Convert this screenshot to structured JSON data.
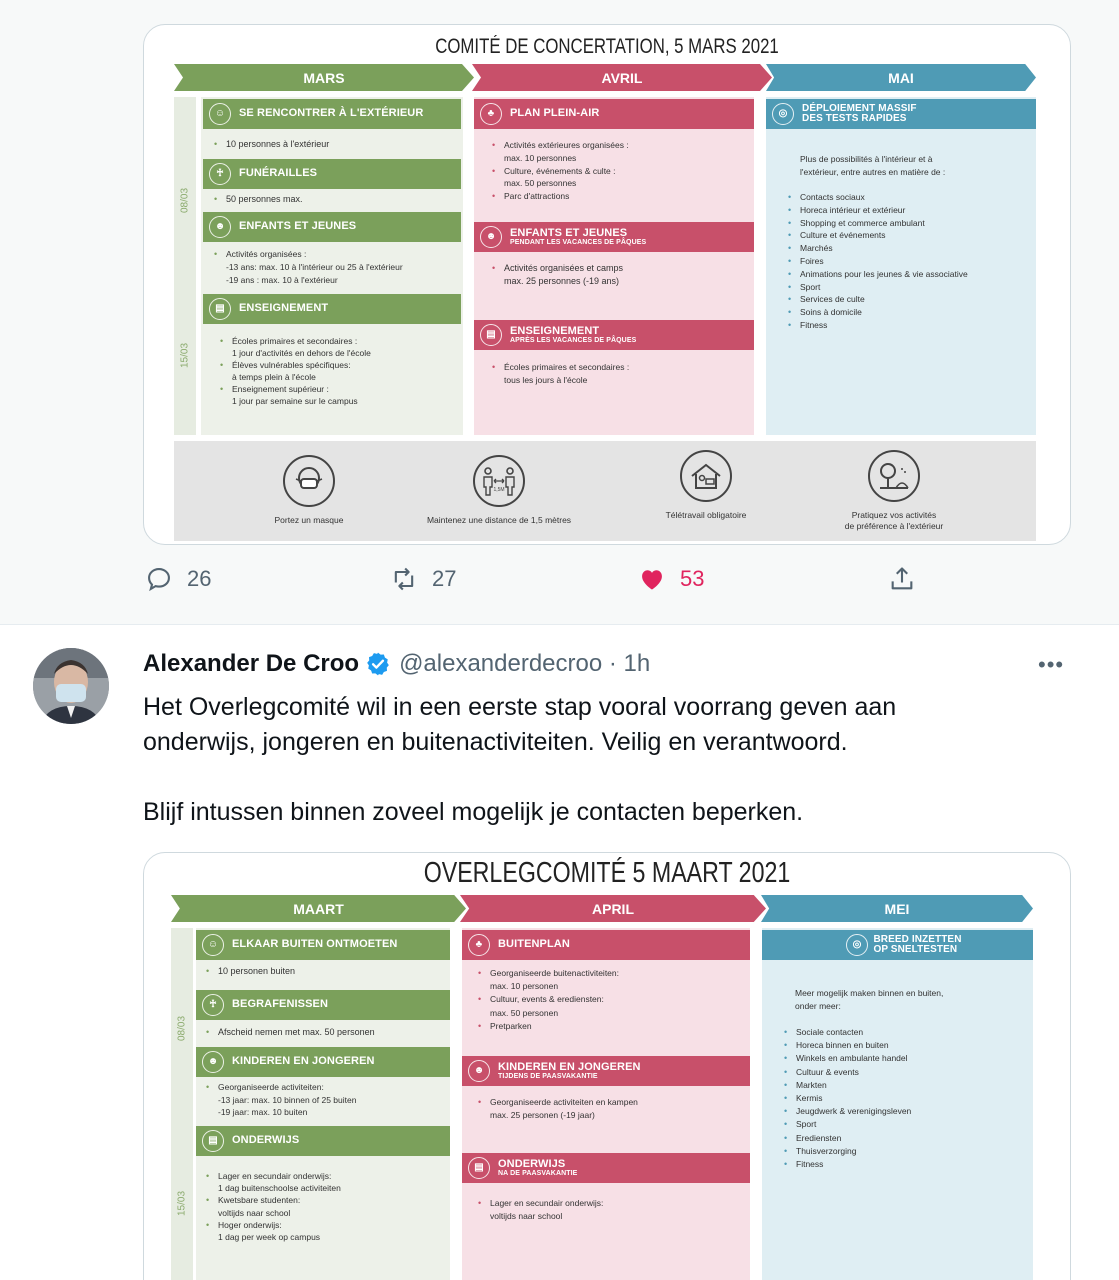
{
  "top_infographic": {
    "title": "COMITÉ DE CONCERTATION, 5 MARS 2021",
    "months": [
      "MARS",
      "AVRIL",
      "MAI"
    ],
    "dates": [
      "08/03",
      "15/03"
    ],
    "col1": {
      "sec1_title": "SE RENCONTRER À L'EXTÉRIEUR",
      "sec1_items": [
        "10 personnes à l'extérieur"
      ],
      "sec2_title": "FUNÉRAILLES",
      "sec2_items": [
        "50 personnes max."
      ],
      "sec3_title": "ENFANTS ET JEUNES",
      "sec3_items": [
        "Activités organisées :\n-13 ans: max. 10 à l'intérieur ou 25 à l'extérieur\n-19 ans : max. 10 à l'extérieur"
      ],
      "sec4_title": "ENSEIGNEMENT",
      "sec4_items": [
        "Écoles primaires et secondaires :\n1 jour d'activités en dehors de l'école",
        "Élèves vulnérables spécifiques:\nà temps plein à l'école",
        "Enseignement supérieur :\n1 jour par semaine sur le campus"
      ]
    },
    "col2": {
      "sec1_title": "PLAN PLEIN-AIR",
      "sec1_items": [
        "Activités extérieures organisées :\nmax. 10 personnes",
        "Culture, événements & culte :\nmax. 50 personnes",
        "Parc d'attractions"
      ],
      "sec2_title": "ENFANTS ET JEUNES",
      "sec2_sub": "PENDANT LES VACANCES DE PÂQUES",
      "sec2_items": [
        "Activités organisées et camps\nmax. 25 personnes (-19 ans)"
      ],
      "sec3_title": "ENSEIGNEMENT",
      "sec3_sub": "APRÈS LES VACANCES DE PÂQUES",
      "sec3_items": [
        "Écoles primaires et secondaires :\ntous les jours à l'école"
      ]
    },
    "col3": {
      "title_line1": "DÉPLOIEMENT MASSIF",
      "title_line2": "DES TESTS RAPIDES",
      "intro": "Plus de possibilités à l'intérieur et à\nl'extérieur, entre autres en matière de :",
      "items": [
        "Contacts sociaux",
        "Horeca intérieur et extérieur",
        "Shopping et commerce ambulant",
        "Culture et événements",
        "Marchés",
        "Foires",
        "Animations pour les jeunes & vie associative",
        "Sport",
        "Services de culte",
        "Soins à domicile",
        "Fitness"
      ]
    },
    "pictos": [
      "Portez un masque",
      "Maintenez une distance de 1,5 mètres",
      "Télétravail obligatoire",
      "Pratiquez vos activités\nde préférence à l'extérieur"
    ],
    "distance_label": "1,5M"
  },
  "actions": {
    "replies": "26",
    "retweets": "27",
    "likes": "53"
  },
  "tweet": {
    "author_name": "Alexander De Croo",
    "handle_time": "@alexanderdecroo · 1h",
    "more": "•••",
    "text": "Het Overlegcomité wil in een eerste stap vooral voorrang geven aan\nonderwijs, jongeren en buitenactiviteiten. Veilig en verantwoord.\n\nBlijf intussen binnen zoveel mogelijk je contacten beperken."
  },
  "bottom_infographic": {
    "title": "OVERLEGCOMITÉ 5 MAART 2021",
    "months": [
      "MAART",
      "APRIL",
      "MEI"
    ],
    "dates": [
      "08/03",
      "15/03"
    ],
    "col1": {
      "sec1_title": "ELKAAR BUITEN ONTMOETEN",
      "sec1_items": [
        "10 personen buiten"
      ],
      "sec2_title": "BEGRAFENISSEN",
      "sec2_items": [
        "Afscheid nemen met max. 50 personen"
      ],
      "sec3_title": "KINDEREN EN JONGEREN",
      "sec3_items": [
        "Georganiseerde activiteiten:\n-13 jaar: max. 10 binnen of 25 buiten\n-19 jaar: max. 10 buiten"
      ],
      "sec4_title": "ONDERWIJS",
      "sec4_items": [
        "Lager en secundair onderwijs:\n1 dag buitenschoolse activiteiten",
        "Kwetsbare studenten:\nvoltijds naar school",
        "Hoger onderwijs:\n1 dag per week op campus"
      ]
    },
    "col2": {
      "sec1_title": "BUITENPLAN",
      "sec1_items": [
        "Georganiseerde buitenactiviteiten:\nmax. 10 personen",
        "Cultuur, events & erediensten:\nmax. 50 personen",
        "Pretparken"
      ],
      "sec2_title": "KINDEREN EN JONGEREN",
      "sec2_sub": "TIJDENS DE PAASVAKANTIE",
      "sec2_items": [
        "Georganiseerde activiteiten en kampen\nmax. 25 personen (-19 jaar)"
      ],
      "sec3_title": "ONDERWIJS",
      "sec3_sub": "NA DE PAASVAKANTIE",
      "sec3_items": [
        "Lager en secundair onderwijs:\nvoltijds naar school"
      ]
    },
    "col3": {
      "title_line1": "BREED INZETTEN",
      "title_line2": "OP SNELTESTEN",
      "intro": "Meer mogelijk maken binnen en buiten,\nonder meer:",
      "items": [
        "Sociale contacten",
        "Horeca binnen en buiten",
        "Winkels en ambulante handel",
        "Cultuur & events",
        "Markten",
        "Kermis",
        "Jeugdwerk & verenigingsleven",
        "Sport",
        "Erediensten",
        "Thuisverzorging",
        "Fitness"
      ]
    }
  }
}
